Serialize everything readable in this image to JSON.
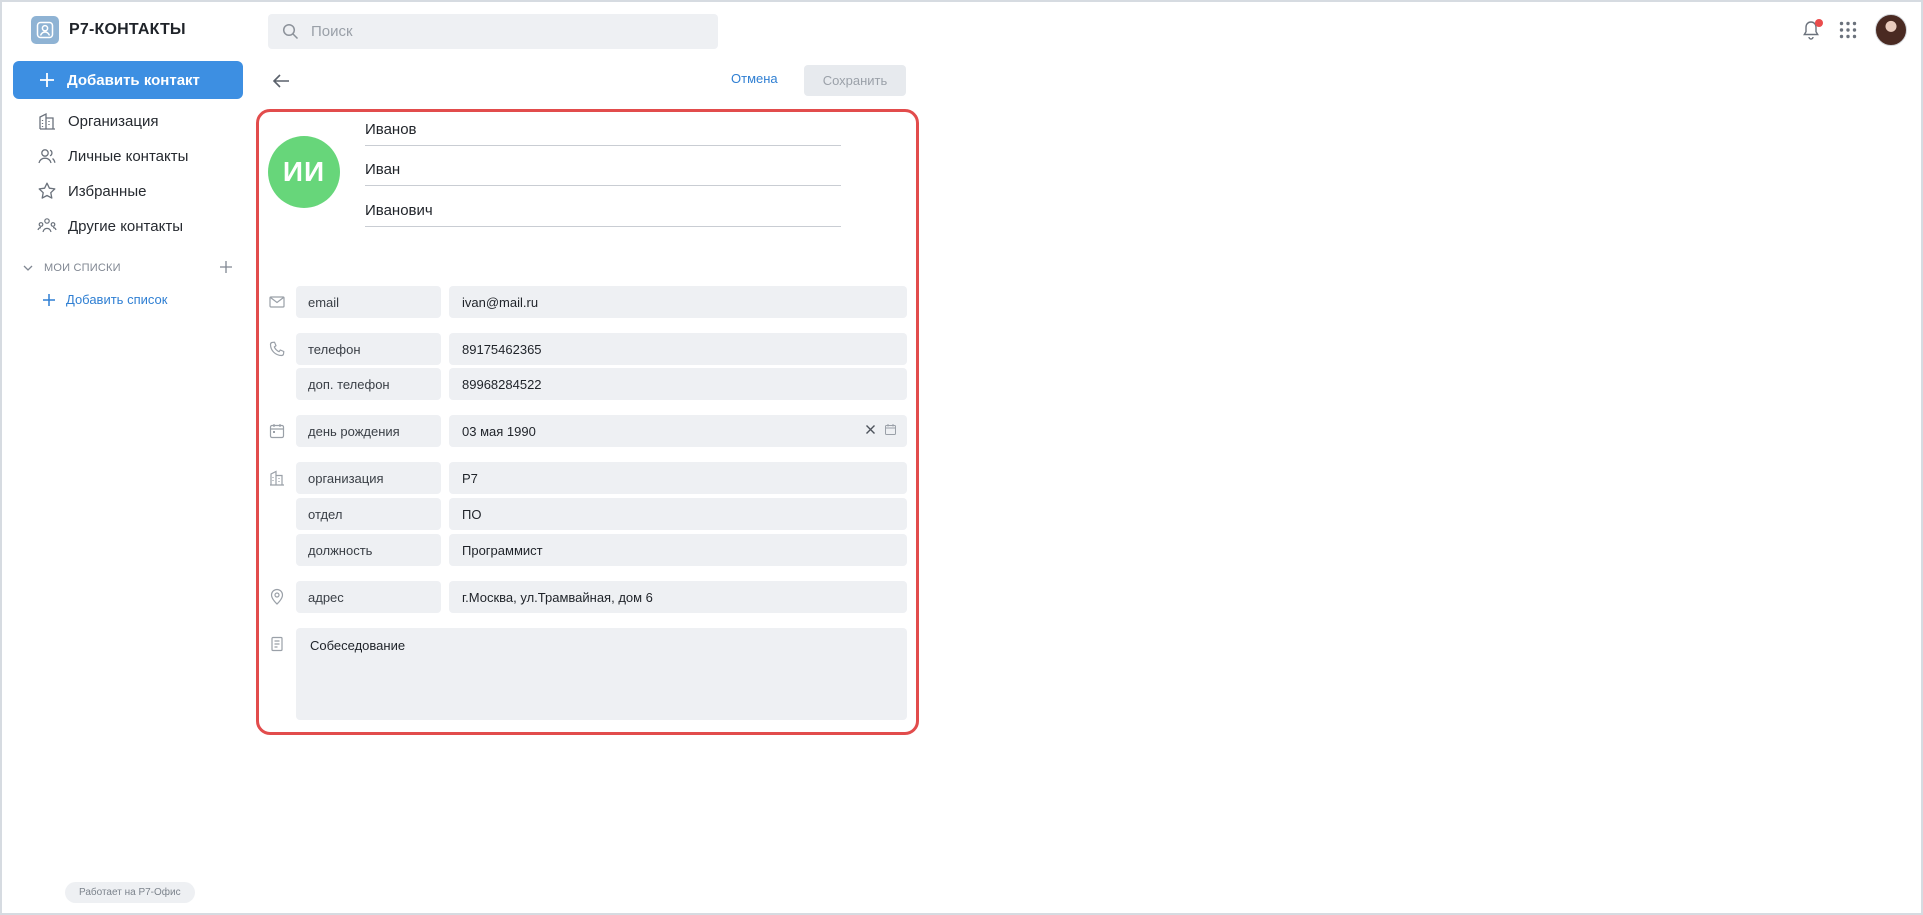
{
  "app": {
    "title": "Р7-КОНТАКТЫ",
    "powered_by": "Работает на Р7-Офис"
  },
  "sidebar": {
    "add_contact": "Добавить контакт",
    "items": [
      {
        "label": "Организация",
        "icon": "building-icon"
      },
      {
        "label": "Личные контакты",
        "icon": "people-icon"
      },
      {
        "label": "Избранные",
        "icon": "star-icon"
      },
      {
        "label": "Другие контакты",
        "icon": "group-icon"
      }
    ],
    "my_lists": "МОИ СПИСКИ",
    "add_list": "Добавить список"
  },
  "search": {
    "placeholder": "Поиск",
    "value": ""
  },
  "toolbar": {
    "cancel": "Отмена",
    "save": "Сохранить"
  },
  "contact": {
    "initials": "ИИ",
    "last_name": "Иванов",
    "first_name": "Иван",
    "middle_name": "Иванович",
    "fields": {
      "email": {
        "label": "email",
        "value": "ivan@mail.ru"
      },
      "phone": {
        "label": "телефон",
        "value": "89175462365"
      },
      "phone2": {
        "label": "доп. телефон",
        "value": "89968284522"
      },
      "birthday": {
        "label": "день рождения",
        "value": "03 мая 1990"
      },
      "org": {
        "label": "организация",
        "value": "Р7"
      },
      "dept": {
        "label": "отдел",
        "value": "ПО"
      },
      "position": {
        "label": "должность",
        "value": "Программист"
      },
      "address": {
        "label": "адрес",
        "value": "г.Москва, ул.Трамвайная, дом 6"
      }
    },
    "note": "Собеседование"
  },
  "colors": {
    "accent": "#3d8fe2",
    "highlight": "#e24c4c",
    "avatar": "#67d67a"
  }
}
